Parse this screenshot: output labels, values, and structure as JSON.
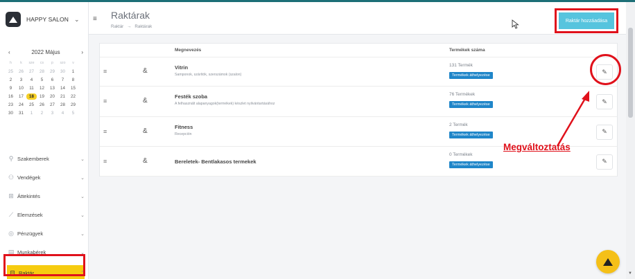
{
  "brand": {
    "name": "HAPPY SALON",
    "logo_icon": "salon-logo-icon"
  },
  "calendar": {
    "month_label": "2022 Május",
    "weekdays": [
      "h",
      "k",
      "sze",
      "cs",
      "p",
      "szo",
      "v"
    ],
    "weeks": [
      [
        {
          "d": "25",
          "m": true
        },
        {
          "d": "26",
          "m": true
        },
        {
          "d": "27",
          "m": true
        },
        {
          "d": "28",
          "m": true
        },
        {
          "d": "29",
          "m": true
        },
        {
          "d": "30",
          "m": true
        },
        {
          "d": "1"
        }
      ],
      [
        {
          "d": "2"
        },
        {
          "d": "3"
        },
        {
          "d": "4"
        },
        {
          "d": "5"
        },
        {
          "d": "6"
        },
        {
          "d": "7"
        },
        {
          "d": "8"
        }
      ],
      [
        {
          "d": "9"
        },
        {
          "d": "10"
        },
        {
          "d": "11"
        },
        {
          "d": "12"
        },
        {
          "d": "13"
        },
        {
          "d": "14"
        },
        {
          "d": "15"
        }
      ],
      [
        {
          "d": "16"
        },
        {
          "d": "17"
        },
        {
          "d": "18",
          "sel": true
        },
        {
          "d": "19"
        },
        {
          "d": "20"
        },
        {
          "d": "21"
        },
        {
          "d": "22"
        }
      ],
      [
        {
          "d": "23"
        },
        {
          "d": "24"
        },
        {
          "d": "25"
        },
        {
          "d": "26"
        },
        {
          "d": "27"
        },
        {
          "d": "28"
        },
        {
          "d": "29"
        }
      ],
      [
        {
          "d": "30"
        },
        {
          "d": "31"
        },
        {
          "d": "1",
          "m": true
        },
        {
          "d": "2",
          "m": true
        },
        {
          "d": "3",
          "m": true
        },
        {
          "d": "4",
          "m": true
        },
        {
          "d": "5",
          "m": true
        }
      ]
    ]
  },
  "nav": [
    {
      "label": "Szakemberek",
      "icon": "person-icon",
      "glyph": "⚲"
    },
    {
      "label": "Vendégek",
      "icon": "users-icon",
      "glyph": "⚇"
    },
    {
      "label": "Áttekintés",
      "icon": "grid-icon",
      "glyph": "⊞"
    },
    {
      "label": "Elemzések",
      "icon": "chart-icon",
      "glyph": "⟋"
    },
    {
      "label": "Pénzügyek",
      "icon": "coin-icon",
      "glyph": "◎"
    },
    {
      "label": "Munkabérek",
      "icon": "wallet-icon",
      "glyph": "▤"
    },
    {
      "label": "Raktár",
      "icon": "warehouse-icon",
      "glyph": "⊟",
      "active": true
    }
  ],
  "header": {
    "title": "Raktárak",
    "breadcrumb": [
      "Raktár",
      "Raktárak"
    ],
    "add_button": "Raktár hozzáadása"
  },
  "table": {
    "col_name": "Megnevezés",
    "col_count": "Termékek száma",
    "move_label": "Termékek áthelyezése",
    "rows": [
      {
        "name": "Vitrin",
        "desc": "Samponok, szárítók, szerszámok (szalon)",
        "count": "131 Termék"
      },
      {
        "name": "Festék szoba",
        "desc": "A felhasznált alapanyagok(termékek) készlet nyilvántartásához",
        "count": "76 Termékek"
      },
      {
        "name": "Fitness",
        "desc": "Recepción",
        "count": "2 Termék"
      },
      {
        "name": "Bereletek- Bentlakasos termekek",
        "desc": "",
        "count": "0 Termékek"
      }
    ]
  },
  "annotation": {
    "text": "Megváltoztatás"
  },
  "colors": {
    "accent": "#56c4de",
    "highlight": "#e0111b",
    "active": "#f6cc10",
    "move": "#1f86c9"
  }
}
